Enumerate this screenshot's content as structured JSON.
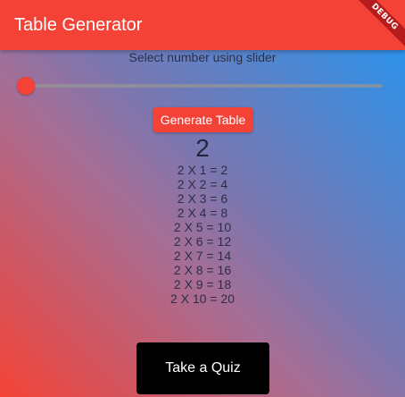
{
  "appbar": {
    "title": "Table Generator",
    "color": "#f44336"
  },
  "debug_banner": {
    "label": "DEBUG"
  },
  "slider": {
    "label": "Select number using slider",
    "value": 2,
    "position_fraction": 0.0
  },
  "buttons": {
    "generate_label": "Generate Table",
    "quiz_label": "Take a Quiz"
  },
  "selected_number": "2",
  "table": [
    "2 X 1 = 2",
    "2 X 2 = 4",
    "2 X 3 = 6",
    "2 X 4 = 8",
    "2 X 5 = 10",
    "2 X 6 = 12",
    "2 X 7 = 14",
    "2 X 8 = 16",
    "2 X 9 = 18",
    "2 X 10 = 20"
  ],
  "colors": {
    "accent": "#f44336",
    "gradient_top_right": "#2196f3",
    "gradient_bottom_left": "#f44336",
    "quiz_button": "#000000"
  }
}
